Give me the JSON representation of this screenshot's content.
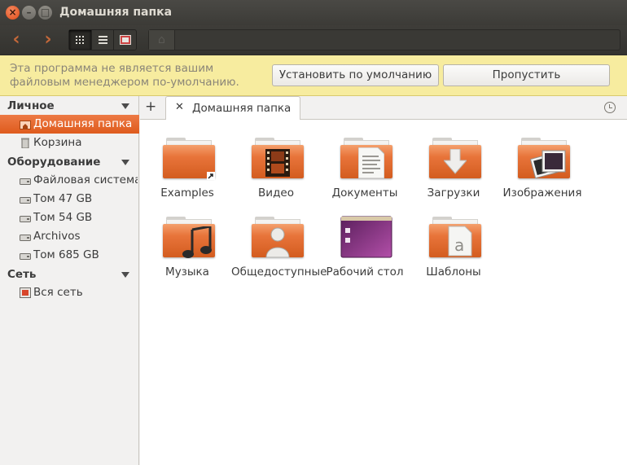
{
  "window": {
    "title": "Домашняя папка"
  },
  "toolbar": {
    "back_icon": "chevron-left-icon",
    "forward_icon": "chevron-right-icon",
    "views": [
      "grid-view-icon",
      "list-view-icon",
      "compact-view-icon"
    ]
  },
  "infobar": {
    "message": "Эта программа не является вашим файловым менеджером по-умолчанию.",
    "set_default_label": "Установить по умолчанию",
    "skip_label": "Пропустить"
  },
  "sidebar": {
    "sections": [
      {
        "title": "Личное",
        "items": [
          {
            "label": "Домашняя папка",
            "icon": "home-folder-icon",
            "selected": true
          },
          {
            "label": "Корзина",
            "icon": "trash-icon"
          }
        ]
      },
      {
        "title": "Оборудование",
        "items": [
          {
            "label": "Файловая система",
            "icon": "drive-icon"
          },
          {
            "label": "Том 47 GB",
            "icon": "drive-icon"
          },
          {
            "label": "Том 54 GB",
            "icon": "drive-icon"
          },
          {
            "label": "Archivos",
            "icon": "drive-icon"
          },
          {
            "label": "Том 685 GB",
            "icon": "drive-icon"
          }
        ]
      },
      {
        "title": "Сеть",
        "items": [
          {
            "label": "Вся сеть",
            "icon": "network-icon"
          }
        ]
      }
    ]
  },
  "tabs": [
    {
      "label": "Домашняя папка"
    }
  ],
  "files": [
    {
      "label": "Examples",
      "icon": "folder-link-icon"
    },
    {
      "label": "Видео",
      "icon": "folder-video-icon"
    },
    {
      "label": "Документы",
      "icon": "folder-documents-icon"
    },
    {
      "label": "Загрузки",
      "icon": "folder-downloads-icon"
    },
    {
      "label": "Изображения",
      "icon": "folder-pictures-icon"
    },
    {
      "label": "Музыка",
      "icon": "folder-music-icon"
    },
    {
      "label": "Общедоступные",
      "icon": "folder-public-icon"
    },
    {
      "label": "Рабочий стол",
      "icon": "folder-desktop-icon"
    },
    {
      "label": "Шаблоны",
      "icon": "folder-templates-icon"
    }
  ],
  "colors": {
    "accent": "#de5b1d",
    "titlebar": "#3c3b37",
    "infobar": "#f7ec9f"
  }
}
